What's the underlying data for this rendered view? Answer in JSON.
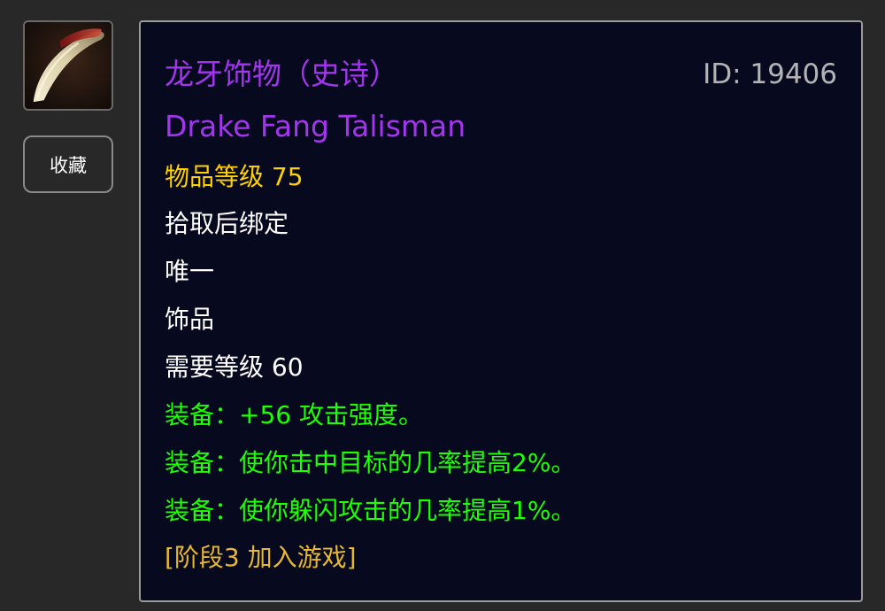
{
  "colors": {
    "epic": "#a335ee",
    "id_gray": "#b4b4b4",
    "white": "#ffffff",
    "level_gold": "#ffd100",
    "equip_green": "#1eff00",
    "phase_gold": "#e8b830"
  },
  "icon": {
    "name": "drake-fang-icon"
  },
  "favorite_button": {
    "label": "收藏"
  },
  "item": {
    "name_cn": "龙牙饰物（史诗）",
    "id_text": "ID: 19406",
    "name_en": "Drake Fang Talisman",
    "item_level": "物品等级 75",
    "bind": "拾取后绑定",
    "unique": "唯一",
    "slot": "饰品",
    "required_level": "需要等级 60",
    "effects": [
      "装备：+56 攻击强度。",
      "装备：使你击中目标的几率提高2%。",
      "装备：使你躲闪攻击的几率提高1%。"
    ],
    "phase": "[阶段3 加入游戏]"
  }
}
